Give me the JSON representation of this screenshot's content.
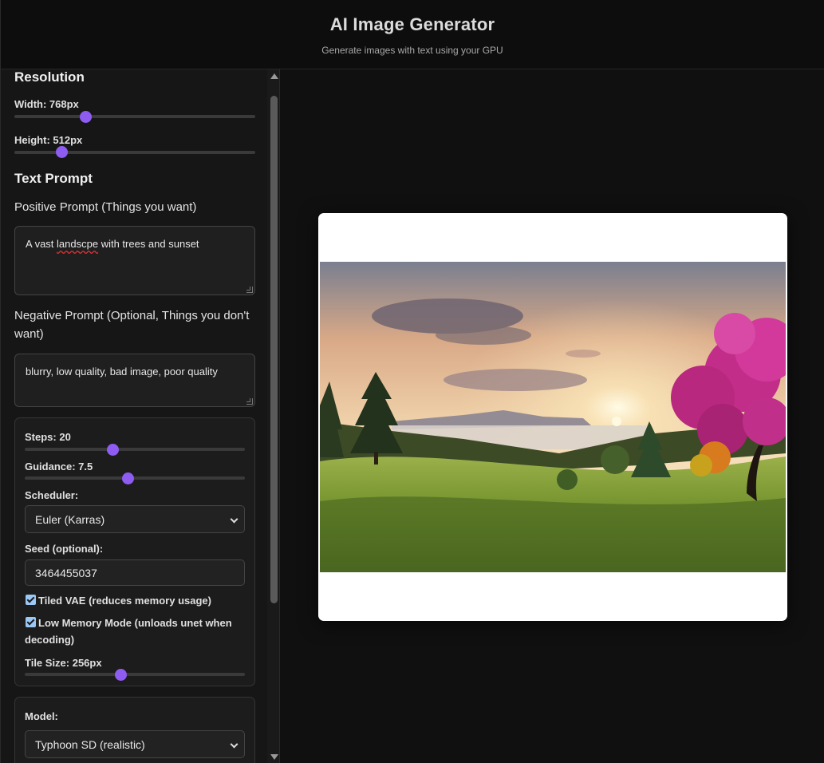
{
  "header": {
    "title": "AI Image Generator",
    "subtitle": "Generate images with text using your GPU"
  },
  "resolution": {
    "title": "Resolution",
    "width_label": "Width: 768px",
    "width_value": 768,
    "height_label": "Height: 512px",
    "height_value": 512
  },
  "prompt": {
    "title": "Text Prompt",
    "positive_label": "Positive Prompt (Things you want)",
    "positive_value_pre": "A vast ",
    "positive_value_misspelled": "landscpe",
    "positive_value_post": " with trees and sunset",
    "negative_label": "Negative Prompt (Optional, Things you don't want)",
    "negative_value": "blurry, low quality, bad image, poor quality"
  },
  "settings": {
    "steps_label": "Steps: 20",
    "steps_value": 20,
    "guidance_label": "Guidance: 7.5",
    "guidance_value": 7.5,
    "scheduler_label": "Scheduler:",
    "scheduler_value": "Euler (Karras)",
    "seed_label": "Seed (optional):",
    "seed_value": "3464455037",
    "tiled_vae_label": "Tiled VAE (reduces memory usage)",
    "tiled_vae_checked": true,
    "low_memory_label": "Low Memory Mode (unloads unet when decoding)",
    "low_memory_checked": true,
    "tile_size_label": "Tile Size: 256px",
    "tile_size_value": 256
  },
  "model": {
    "label": "Model:",
    "value": "Typhoon SD (realistic)"
  },
  "colors": {
    "accent": "#8e5cf0",
    "background": "#101010",
    "panel": "#1c1c1c"
  }
}
